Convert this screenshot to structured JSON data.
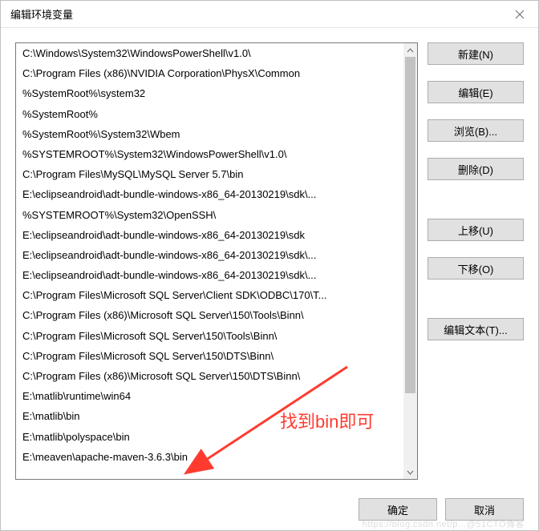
{
  "titlebar": {
    "title": "编辑环境变量"
  },
  "list": {
    "items": [
      "C:\\Windows\\System32\\WindowsPowerShell\\v1.0\\",
      "C:\\Program Files (x86)\\NVIDIA Corporation\\PhysX\\Common",
      "%SystemRoot%\\system32",
      "%SystemRoot%",
      "%SystemRoot%\\System32\\Wbem",
      "%SYSTEMROOT%\\System32\\WindowsPowerShell\\v1.0\\",
      "C:\\Program Files\\MySQL\\MySQL Server 5.7\\bin",
      "E:\\eclipseandroid\\adt-bundle-windows-x86_64-20130219\\sdk\\...",
      "%SYSTEMROOT%\\System32\\OpenSSH\\",
      "E:\\eclipseandroid\\adt-bundle-windows-x86_64-20130219\\sdk",
      "E:\\eclipseandroid\\adt-bundle-windows-x86_64-20130219\\sdk\\...",
      "E:\\eclipseandroid\\adt-bundle-windows-x86_64-20130219\\sdk\\...",
      "C:\\Program Files\\Microsoft SQL Server\\Client SDK\\ODBC\\170\\T...",
      "C:\\Program Files (x86)\\Microsoft SQL Server\\150\\Tools\\Binn\\",
      "C:\\Program Files\\Microsoft SQL Server\\150\\Tools\\Binn\\",
      "C:\\Program Files\\Microsoft SQL Server\\150\\DTS\\Binn\\",
      "C:\\Program Files (x86)\\Microsoft SQL Server\\150\\DTS\\Binn\\",
      "E:\\matlib\\runtime\\win64",
      "E:\\matlib\\bin",
      "E:\\matlib\\polyspace\\bin",
      "E:\\meaven\\apache-maven-3.6.3\\bin"
    ]
  },
  "buttons": {
    "new": "新建(N)",
    "edit": "编辑(E)",
    "browse": "浏览(B)...",
    "delete": "删除(D)",
    "moveUp": "上移(U)",
    "moveDown": "下移(O)",
    "editText": "编辑文本(T)..."
  },
  "footer": {
    "ok": "确定",
    "cancel": "取消"
  },
  "annotation": {
    "text": "找到bin即可"
  },
  "watermark": "https://blog.csdn.net/p...@51CTO博客"
}
